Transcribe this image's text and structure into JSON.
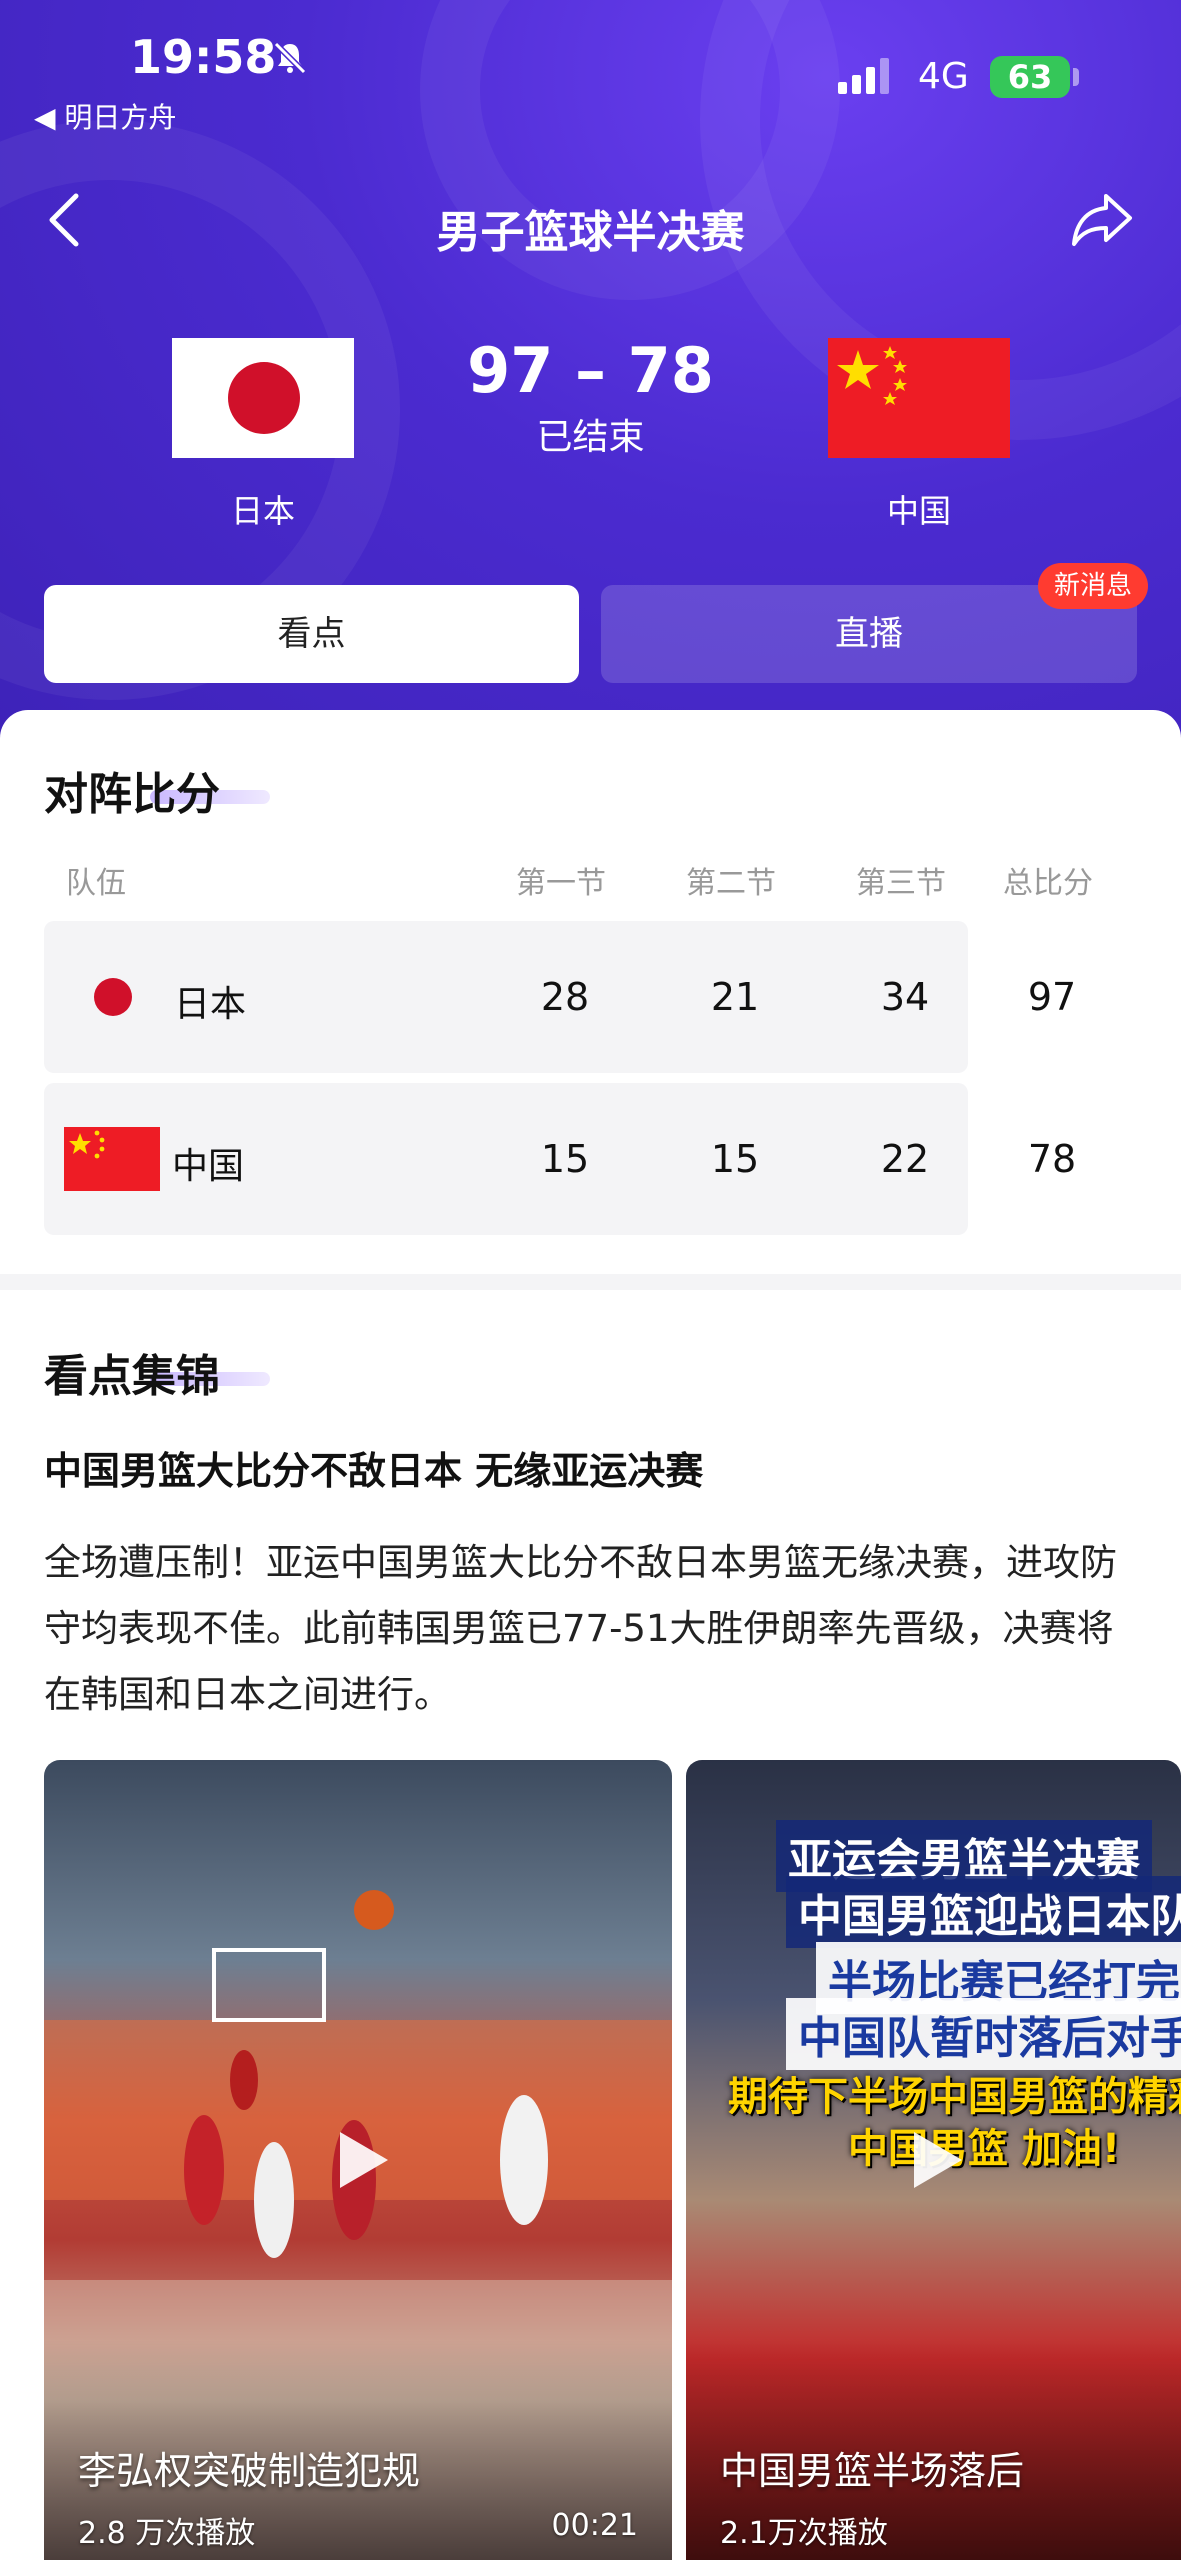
{
  "status_bar": {
    "time": "19:58",
    "back_app": "◀ 明日方舟",
    "network": "4G",
    "battery": "63"
  },
  "header": {
    "title": "男子篮球半决赛"
  },
  "match": {
    "home_team": "日本",
    "away_team": "中国",
    "score": "97 – 78",
    "status": "已结束"
  },
  "tabs": [
    {
      "label": "看点"
    },
    {
      "label": "直播"
    }
  ],
  "tab_badge": "新消息",
  "scoreboard": {
    "title": "对阵比分",
    "headers": [
      "队伍",
      "第一节",
      "第二节",
      "第三节",
      "总比分"
    ],
    "rows": [
      {
        "team": "日本",
        "q1": "28",
        "q2": "21",
        "q3": "34",
        "total": "97"
      },
      {
        "team": "中国",
        "q1": "15",
        "q2": "15",
        "q3": "22",
        "total": "78"
      }
    ]
  },
  "highlights": {
    "title": "看点集锦",
    "headline": "中国男篮大比分不敌日本 无缘亚运决赛",
    "summary": "全场遭压制！亚运中国男篮大比分不敌日本男篮无缘决赛，进攻防守均表现不佳。此前韩国男篮已77-51大胜伊朗率先晋级，决赛将在韩国和日本之间进行。",
    "videos": [
      {
        "title": "李弘权突破制造犯规",
        "views": "2.8 万次播放",
        "duration": "00:21"
      },
      {
        "title": "中国男篮半场落后",
        "views": "2.1万次播放",
        "overlay": [
          "亚运会男篮半决赛",
          "中国男篮迎战日本队",
          "半场比赛已经打完",
          "中国队暂时落后对手",
          "期待下半场中国男篮的精彩",
          "中国男篮 加油!"
        ]
      }
    ]
  },
  "colors": {
    "hero_purple": "#4b2bd0",
    "badge_red": "#ff3b30",
    "battery_green": "#35c759"
  }
}
